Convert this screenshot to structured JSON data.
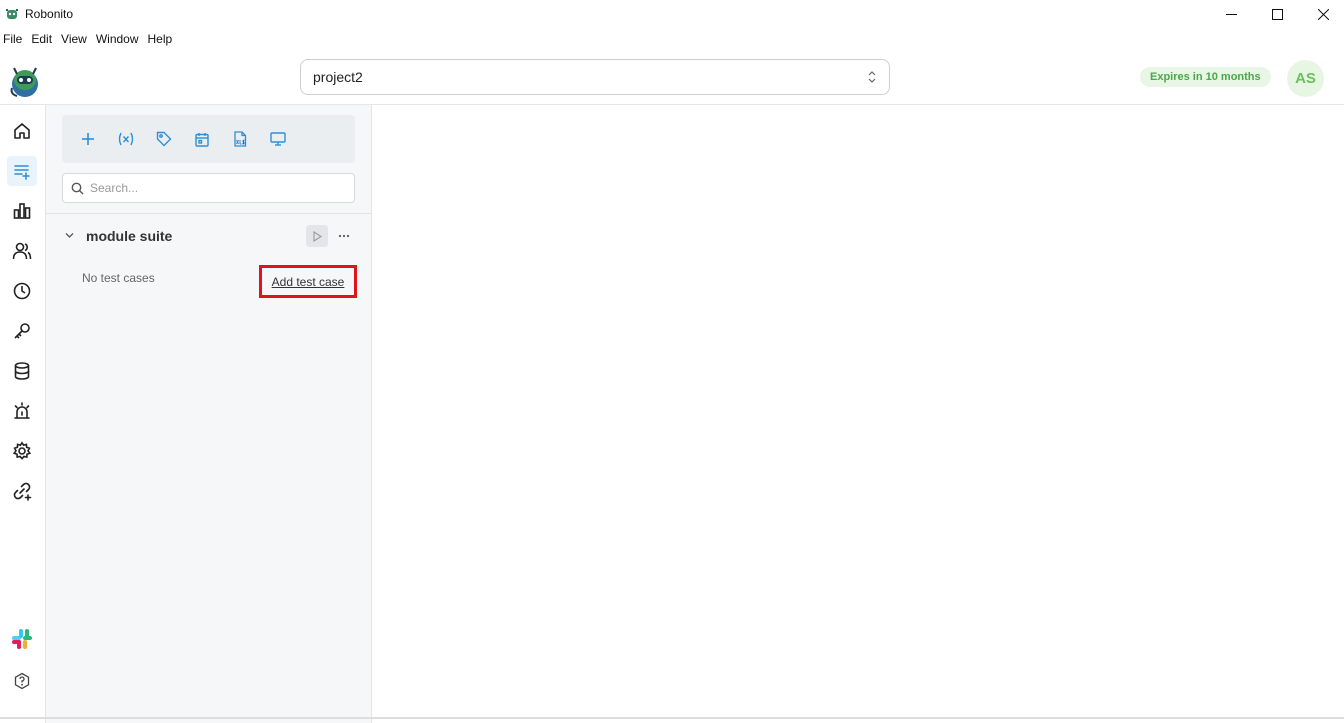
{
  "window": {
    "title": "Robonito",
    "icons": {
      "minimize": "minimize-icon",
      "maximize": "maximize-icon",
      "close": "close-icon"
    }
  },
  "menu": {
    "items": [
      "File",
      "Edit",
      "View",
      "Window",
      "Help"
    ]
  },
  "header": {
    "project": "project2",
    "license_badge": "Expires in 10 months",
    "avatar_initials": "AS",
    "colors": {
      "badge_bg": "#e8f6e6",
      "badge_text": "#4aa84a",
      "avatar_bg": "#e7f5e3",
      "avatar_text": "#6cbf5f"
    }
  },
  "sidebar": {
    "items": [
      {
        "icon": "home-icon",
        "active": false
      },
      {
        "icon": "test-suites-icon",
        "active": true
      },
      {
        "icon": "reports-chart-icon",
        "active": false
      },
      {
        "icon": "users-icon",
        "active": false
      },
      {
        "icon": "history-clock-icon",
        "active": false
      },
      {
        "icon": "key-icon",
        "active": false
      },
      {
        "icon": "database-icon",
        "active": false
      },
      {
        "icon": "alarm-icon",
        "active": false
      },
      {
        "icon": "settings-gear-icon",
        "active": false
      },
      {
        "icon": "integrations-link-icon",
        "active": false
      }
    ],
    "bottom": [
      {
        "icon": "slack-icon"
      },
      {
        "icon": "help-icon"
      }
    ]
  },
  "panel": {
    "toolbar": [
      {
        "icon": "add-icon"
      },
      {
        "icon": "variables-icon"
      },
      {
        "icon": "tag-icon"
      },
      {
        "icon": "calendar-icon"
      },
      {
        "icon": "xls-file-icon"
      },
      {
        "icon": "monitor-icon"
      }
    ],
    "search_placeholder": "Search...",
    "suite": {
      "name": "module suite",
      "empty_text": "No test cases",
      "add_link": "Add test case"
    },
    "accent": "#2d8fd5",
    "highlight": "#e0141d"
  }
}
